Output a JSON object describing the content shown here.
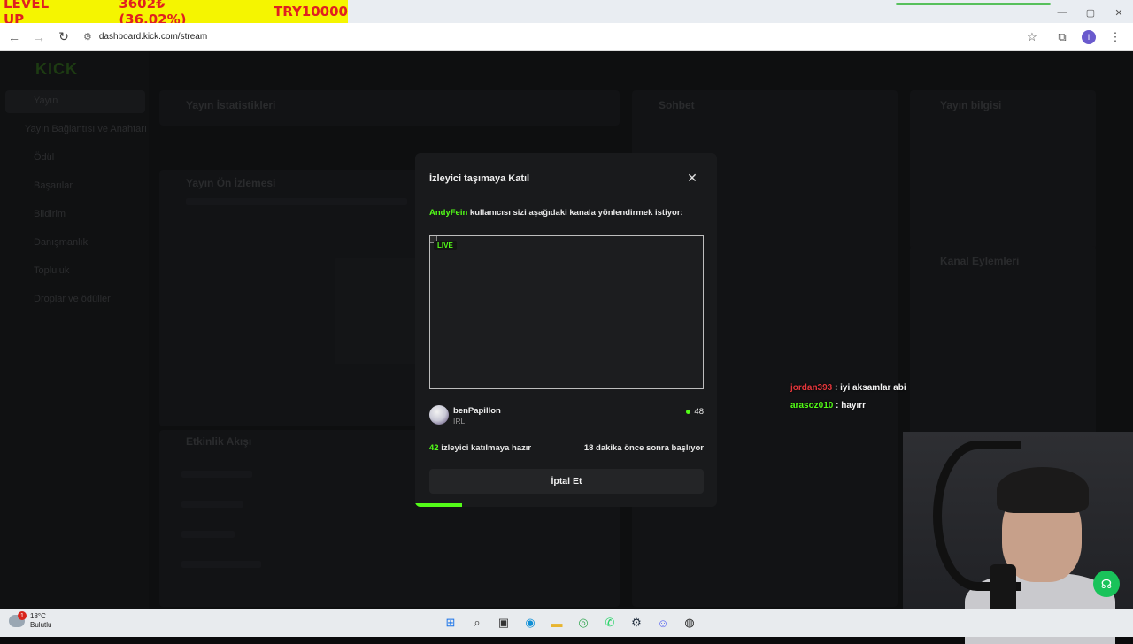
{
  "overlay": {
    "ticker_level": "LEVEL UP",
    "ticker_amount": "3602₺ (36.02%)",
    "ticker_goal": "TRY10000"
  },
  "browser": {
    "url": "dashboard.kick.com/stream",
    "profile_initial": "I"
  },
  "dashboard": {
    "logo": "KICK",
    "sidebar": {
      "items": [
        "Yayın",
        "Yayın Bağlantısı ve Anahtarı",
        "Ödül",
        "Başarılar",
        "Bildirim",
        "Danışmanlık",
        "Topluluk",
        "Droplar ve ödüller"
      ]
    },
    "panels": {
      "stats_title": "Yayın İstatistikleri",
      "preview_title": "Yayın Ön İzlemesi",
      "activity_title": "Etkinlik Akışı",
      "chat_title": "Sohbet",
      "info_title": "Yayın bilgisi",
      "actions_title": "Kanal Eylemleri"
    }
  },
  "modal": {
    "title": "İzleyici taşımaya Katıl",
    "message_user": "AndyFein",
    "message_text": " kullanıcısı sizi aşağıdaki kanala yönlendirmek istiyor:",
    "live_label": "LIVE",
    "channel_name": "benPapillon",
    "channel_category": "IRL",
    "viewer_count": "48",
    "ready_count": "42",
    "ready_text": " izleyici katılmaya hazır",
    "starts_text": "18 dakika önce sonra başlıyor",
    "cancel_label": "İptal Et"
  },
  "chat_overlay": [
    {
      "user": "jordan393",
      "text": " : iyi aksamlar abi"
    },
    {
      "user": "arasoz010",
      "text": " : hayırr"
    }
  ],
  "taskbar": {
    "temp": "18°C",
    "weather": "Bulutlu",
    "notif_count": "1"
  },
  "colors": {
    "kick_green": "#53fc18",
    "ticker_bg": "#f5f500",
    "ticker_text": "#e02020"
  }
}
